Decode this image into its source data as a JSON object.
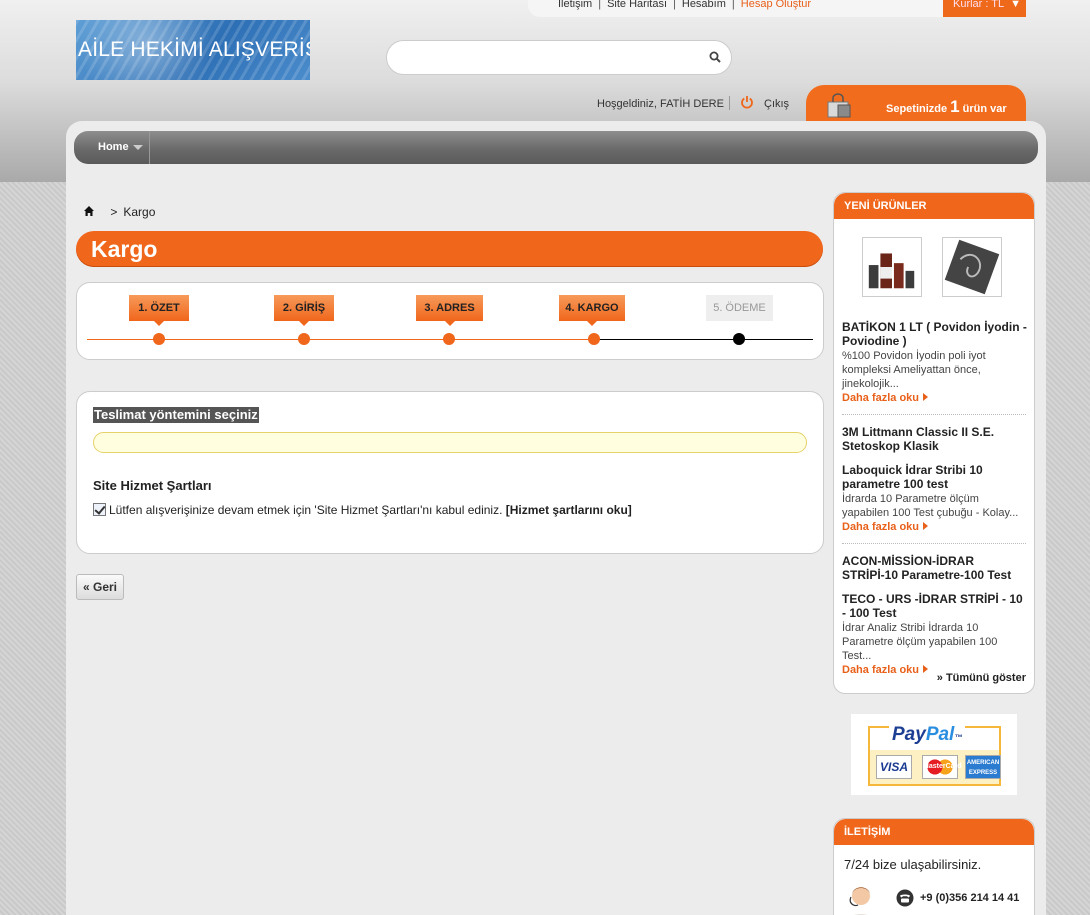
{
  "top_links": [
    "İletişim",
    "Site Haritası",
    "Hesabım"
  ],
  "create_account": "Hesap Oluştur",
  "currency_label": "Kurlar : TL",
  "logo_text": "AİLE HEKİMİ ALIŞVERİŞ",
  "search": {
    "placeholder": ""
  },
  "welcome": "Hoşgeldiniz, FATİH DERE",
  "logout": "Çıkış",
  "cart": {
    "prefix": "Sepetinizde",
    "count": "1",
    "suffix": "ürün var"
  },
  "nav": {
    "home": "Home"
  },
  "breadcrumb": {
    "current": "Kargo"
  },
  "page_title": "Kargo",
  "steps": [
    {
      "label": "1. ÖZET",
      "status": "done"
    },
    {
      "label": "2. GİRİŞ",
      "status": "done"
    },
    {
      "label": "3. ADRES",
      "status": "done"
    },
    {
      "label": "4. KARGO",
      "status": "current"
    },
    {
      "label": "5. ÖDEME",
      "status": "pending"
    }
  ],
  "delivery": {
    "select_title": "Teslimat yöntemini seçiniz",
    "terms_title": "Site Hizmet Şartları",
    "terms_text": "Lütfen alışverişinize devam etmek için 'Site Hizmet Şartları'nı kabul ediniz.",
    "terms_link": "[Hizmet şartlarını oku]",
    "terms_checked": true
  },
  "back_button": "« Geri",
  "sidebar": {
    "new_products_title": "YENİ ÜRÜNLER",
    "products": [
      {
        "name": "BATİKON 1 LT ( Povidon İyodin - Poviodine )",
        "desc": "%100 Povidon İyodin poli iyot kompleksi Ameliyattan önce, jinekolojik...",
        "more": "Daha fazla oku"
      },
      {
        "name": "3M Littmann Classic II S.E. Stetoskop Klasik",
        "desc": "",
        "more": ""
      },
      {
        "name": "Laboquick İdrar Stribi 10 parametre 100 test",
        "desc": "İdrarda 10 Parametre ölçüm yapabilen 100 Test çubuğu -         Kolay...",
        "more": "Daha fazla oku"
      },
      {
        "name": "ACON-MİSSİON-İDRAR STRİPİ-10 Parametre-100 Test",
        "desc": "",
        "more": ""
      },
      {
        "name": "TECO - URS -İDRAR STRİPİ - 10 - 100 Test",
        "desc": "İdrar Analiz Stribi İdrarda 10 Parametre ölçüm yapabilen 100 Test...",
        "more": "Daha fazla oku"
      }
    ],
    "show_all": "» Tümünü göster",
    "paypal": {
      "pay": "Pay",
      "pal": "Pal",
      "tm": "™",
      "visa": "VISA",
      "mastercard": "MasterCard",
      "amex": "AMERICAN EXPRESS"
    },
    "contact_title": "İLETİŞİM",
    "contact_text": "7/24 bize ulaşabilirsiniz.",
    "phone": "+9 (0)356 214 14 41"
  },
  "colors": {
    "accent": "#f0661b",
    "nav": "#6a6a6a",
    "pending_dot": "#000000"
  }
}
